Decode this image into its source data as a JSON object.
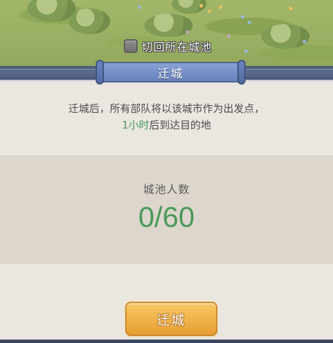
{
  "map": {
    "return_toggle_label": "切回所在城池",
    "return_toggle_checked": false
  },
  "dialog": {
    "title": "迁城",
    "description_line1": "迁城后，所有部队将以该城市作为出发点，",
    "description_highlight": "1小时",
    "description_line2_rest": "后到达目的地",
    "population_label": "城池人数",
    "population_value": "0/60",
    "confirm_button_label": "迁城"
  },
  "colors": {
    "highlight_green": "#4c9a5c",
    "ribbon_blue": "#7690c9",
    "button_orange": "#f0b24a",
    "panel_bg": "#ddd6cd"
  }
}
